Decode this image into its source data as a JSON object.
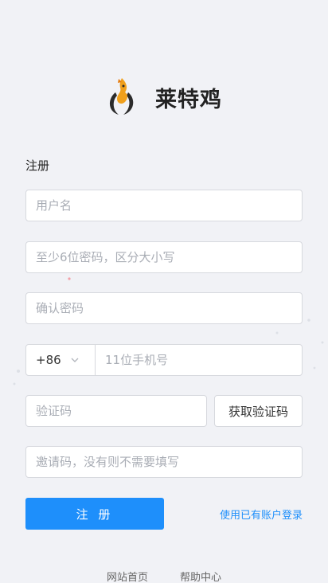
{
  "brand": {
    "name": "莱特鸡",
    "logo_icon": "rooster-flame-icon"
  },
  "form": {
    "title": "注册",
    "username_placeholder": "用户名",
    "password_placeholder": "至少6位密码，区分大小写",
    "confirm_password_placeholder": "确认密码",
    "country_code": "+86",
    "phone_placeholder": "11位手机号",
    "verification_placeholder": "验证码",
    "get_code_label": "获取验证码",
    "invite_placeholder": "邀请码，没有则不需要填写",
    "submit_label": "注 册",
    "login_link": "使用已有账户登录"
  },
  "footer": {
    "home": "网站首页",
    "help": "帮助中心"
  },
  "colors": {
    "accent": "#1e8ffb",
    "background": "#f1f2f6",
    "logo_orange": "#f0a01c"
  }
}
